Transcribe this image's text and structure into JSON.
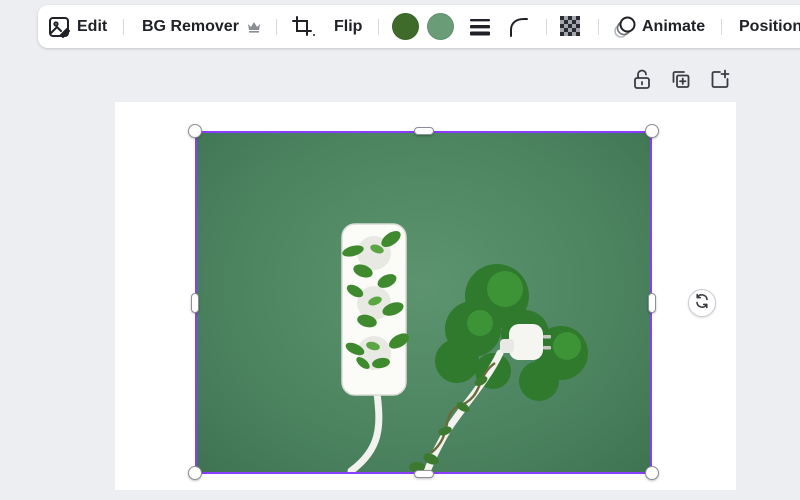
{
  "toolbar": {
    "edit_label": "Edit",
    "bg_remover_label": "BG Remover",
    "flip_label": "Flip",
    "animate_label": "Animate",
    "position_label": "Position",
    "swatch_colors": [
      "#3e6b2a",
      "#6a9c78"
    ]
  },
  "icons": {
    "edit": "image-edit-icon",
    "premium": "crown-icon",
    "crop": "crop-icon",
    "border": "border-weight-icon",
    "corner": "corner-rounding-icon",
    "transparency": "transparency-icon",
    "animate": "animate-icon",
    "lock": "lock-icon",
    "duplicate": "duplicate-icon",
    "add_page": "add-page-icon",
    "rotate": "rotate-icon"
  }
}
